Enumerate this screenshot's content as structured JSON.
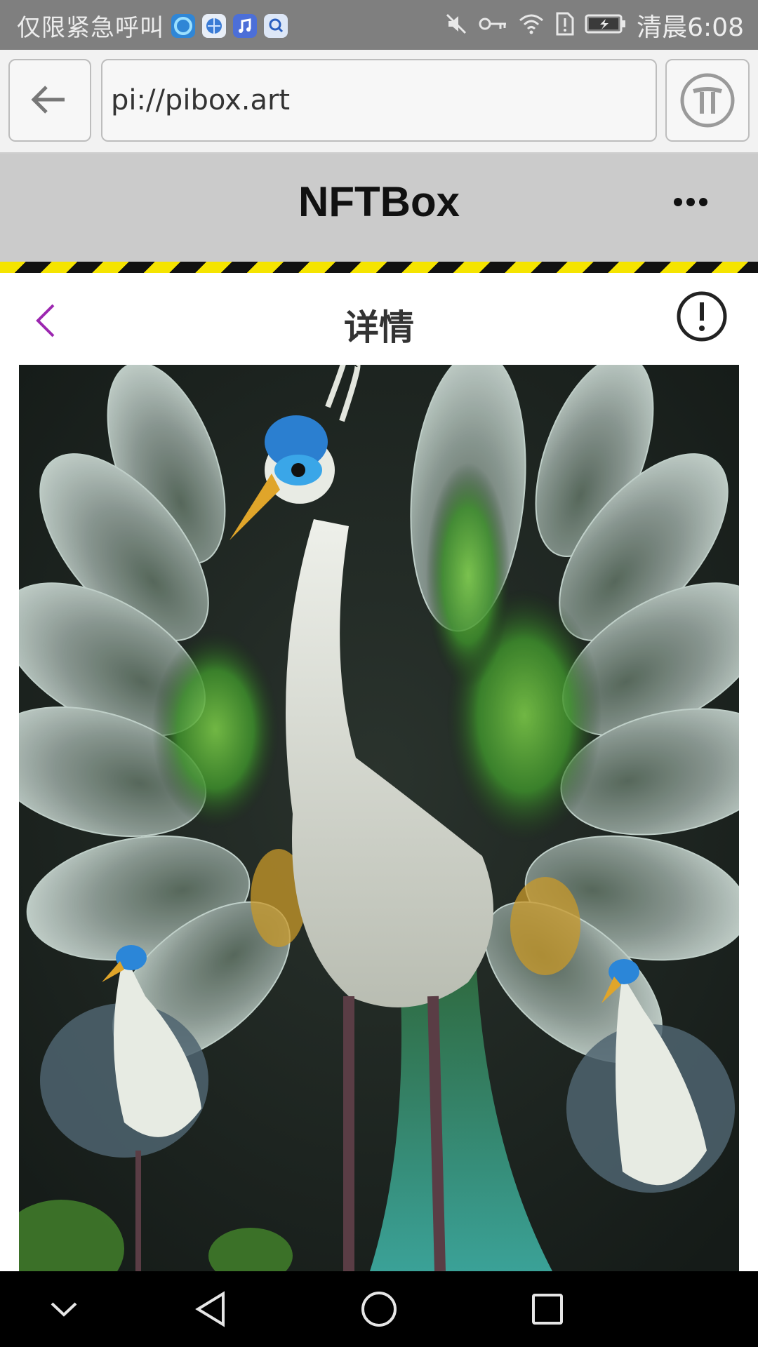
{
  "status_bar": {
    "carrier_text": "仅限紧急呼叫",
    "time": "清晨6:08",
    "app_icons": [
      "browser-swirl-icon",
      "globe-app-icon",
      "music-app-icon",
      "search-app-icon"
    ],
    "status_icons": [
      "mute-icon",
      "key-icon",
      "wifi-icon",
      "sim-alert-icon",
      "battery-charging-icon"
    ]
  },
  "browser": {
    "url": "pi://pibox.art",
    "back_icon": "arrow-left-icon",
    "pi_icon": "pi-logo-icon"
  },
  "app_header": {
    "title": "NFTBox",
    "more_icon": "more-horizontal-icon"
  },
  "page": {
    "title": "详情",
    "back_icon": "chevron-left-icon",
    "info_icon": "info-circle-icon"
  },
  "artwork": {
    "subject": "white peacock artwork"
  },
  "nav_bar": {
    "icons": [
      "chevron-down-icon",
      "back-triangle-icon",
      "home-circle-icon",
      "recents-square-icon"
    ]
  },
  "colors": {
    "status_bar_bg": "#7f7f7f",
    "app_header_bg": "#cbcbcb",
    "accent_purple": "#9c27b0",
    "hazard_yellow": "#f5e400",
    "hazard_black": "#111111"
  }
}
